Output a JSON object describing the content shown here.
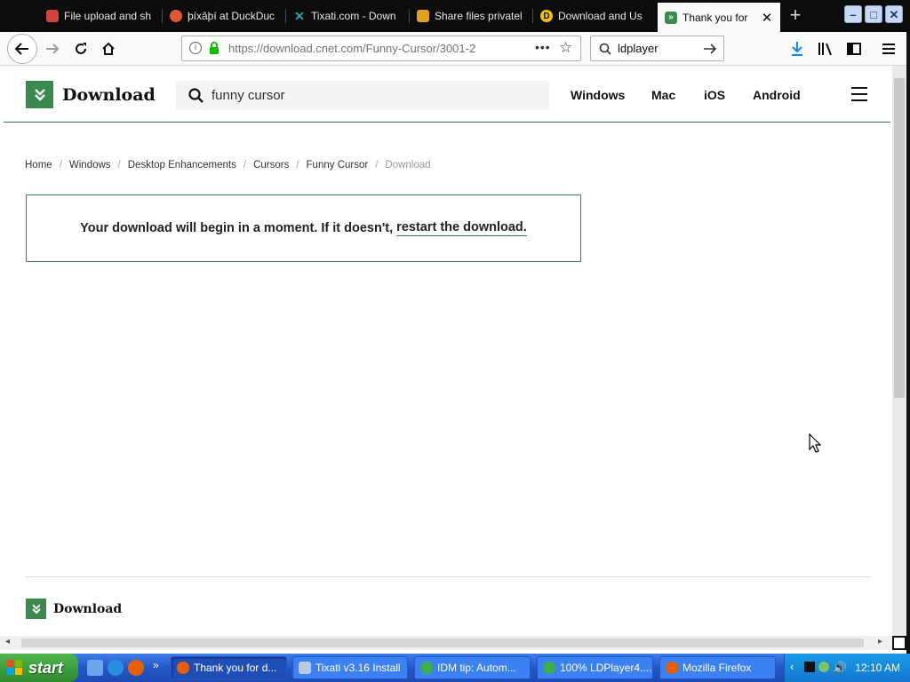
{
  "tabs": [
    {
      "title": "File upload and sh",
      "icon": "dropbox-like-icon",
      "color": "#d0443e"
    },
    {
      "title": "þíxâþí at DuckDuc",
      "icon": "duckduckgo-icon",
      "color": "#de5833"
    },
    {
      "title": "Tixati.com - Down",
      "icon": "tixati-icon",
      "color": "#2aa3a3"
    },
    {
      "title": "Share files privatel",
      "icon": "share-icon",
      "color": "#e0a020"
    },
    {
      "title": "Download and Us",
      "icon": "ldplayer-icon",
      "color": "#f2c200"
    },
    {
      "title": "Thank you for",
      "icon": "download-site-icon",
      "color": "#3a8a4f"
    }
  ],
  "browser": {
    "url": "https://download.cnet.com/Funny-Cursor/3001-2",
    "search_value": "ldplayer"
  },
  "site": {
    "logo_text": "Download",
    "search_value": "funny cursor",
    "nav": [
      "Windows",
      "Mac",
      "iOS",
      "Android"
    ]
  },
  "breadcrumb": [
    "Home",
    "Windows",
    "Desktop Enhancements",
    "Cursors",
    "Funny Cursor",
    "Download"
  ],
  "notice": {
    "text": "Your download will begin in a moment. If it doesn't,",
    "link": "restart the download."
  },
  "footer": {
    "logo_text": "Download"
  },
  "taskbar": {
    "start_label": "start",
    "tasks": [
      "Thank you for d...",
      "Tixati v3.16 Install",
      "IDM tip: Autom...",
      "100% LDPlayer4....",
      "Mozilla Firefox"
    ],
    "clock": "12:10 AM"
  },
  "colors": {
    "brand_green": "#3a8a4f",
    "tab_bar": "#0c0c0d",
    "taskbar_blue": "#2356c9"
  }
}
